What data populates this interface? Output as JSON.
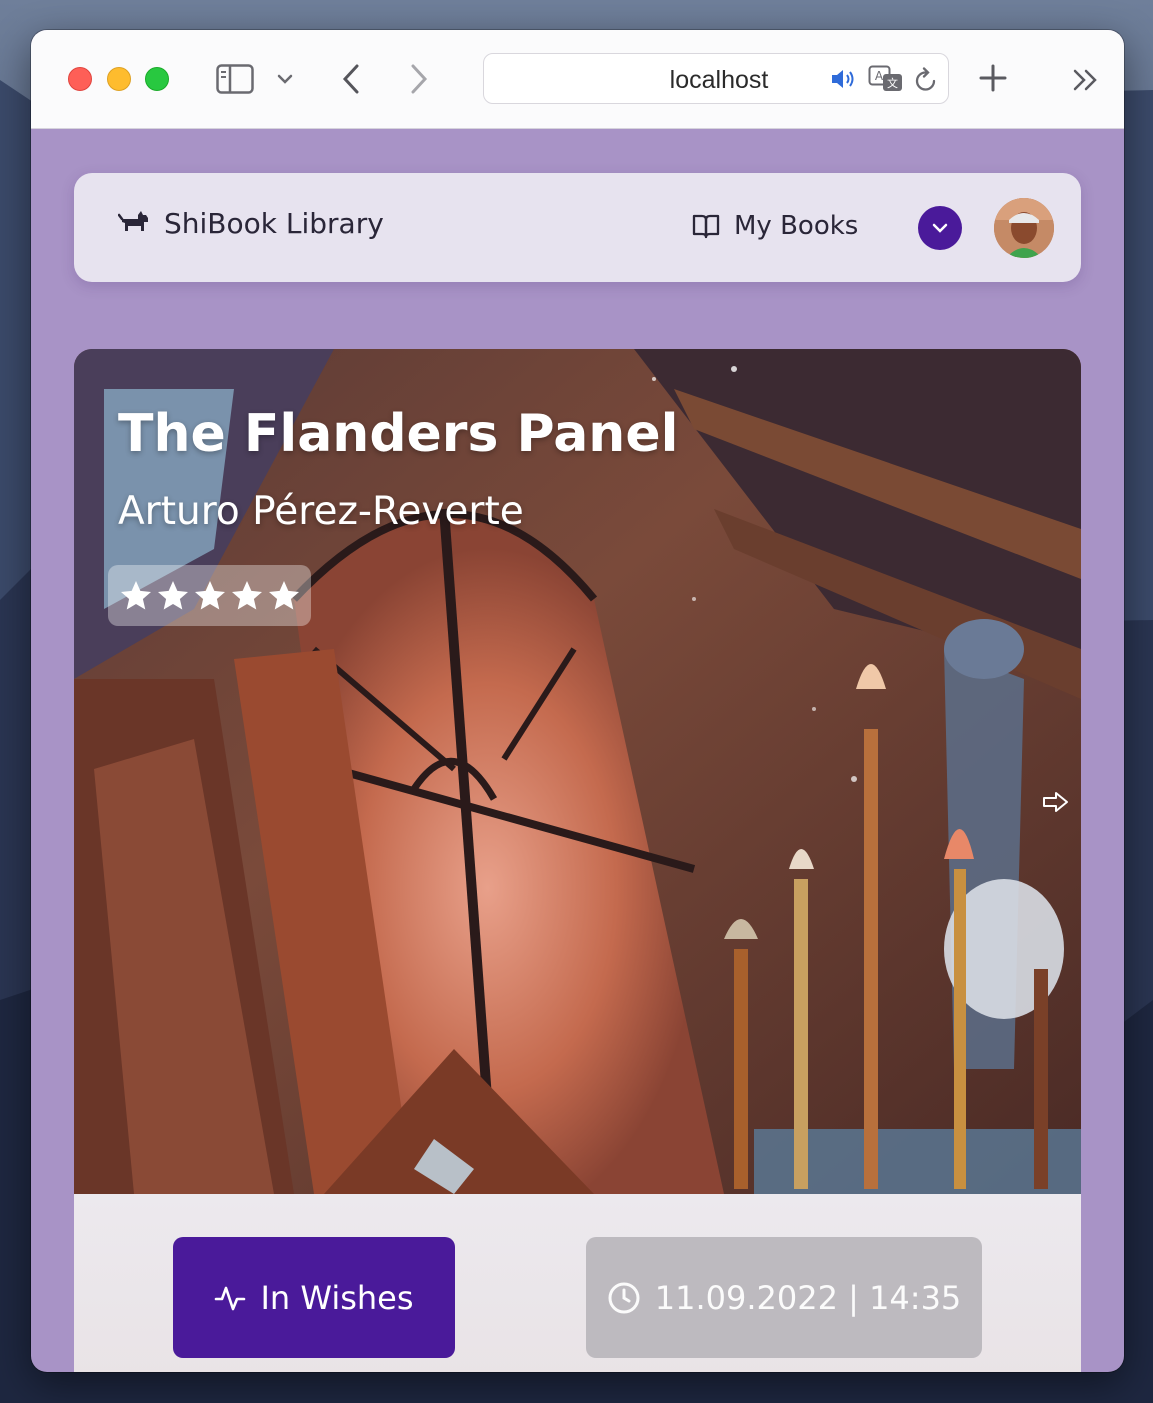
{
  "browser": {
    "url": "localhost",
    "icons": {
      "sidebar": "sidebar-icon",
      "back": "chevron-left-icon",
      "forward": "chevron-right-icon",
      "audio": "speaker-icon",
      "translate": "translate-icon",
      "reload": "reload-icon",
      "new_tab": "plus-icon",
      "more": "double-chevron-icon"
    }
  },
  "navbar": {
    "brand": "ShiBook Library",
    "my_books": "My Books"
  },
  "book": {
    "title": "The Flanders Panel",
    "author": "Arturo Pérez-Reverte",
    "rating": 5,
    "rating_max": 5
  },
  "actions": {
    "wish_label": "In Wishes",
    "datetime": "11.09.2022 | 14:35"
  },
  "colors": {
    "accent": "#4a1a9a",
    "page_bg": "#a893c6"
  }
}
